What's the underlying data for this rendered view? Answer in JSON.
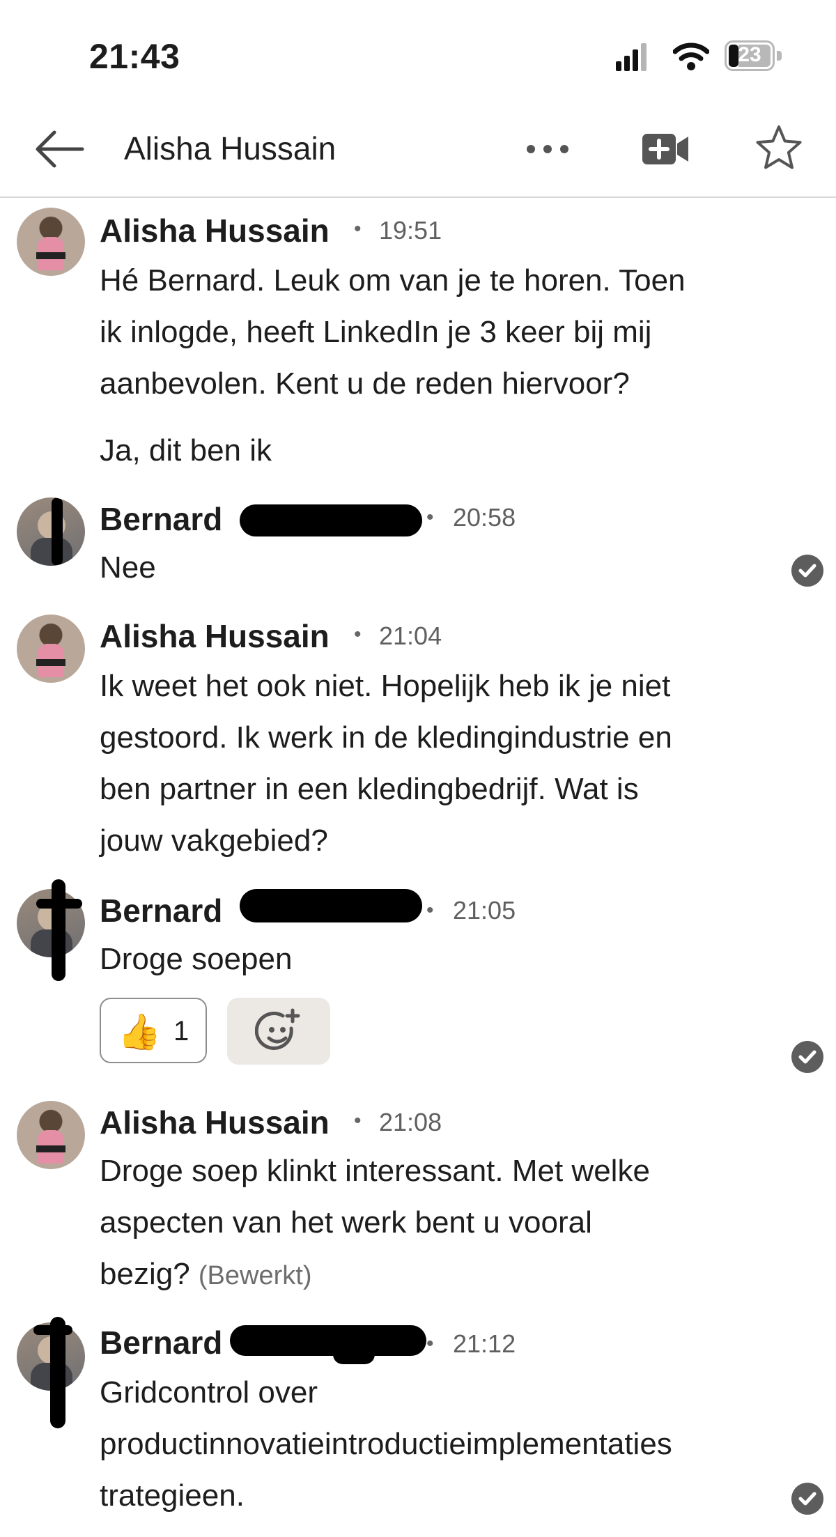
{
  "status_bar": {
    "time": "21:43",
    "battery": "23"
  },
  "header": {
    "back_icon": "arrow-left-icon",
    "title": "Alisha Hussain",
    "more_icon": "more-horizontal-icon",
    "video_icon": "video-call-icon",
    "star_icon": "star-outline-icon"
  },
  "colors": {
    "text": "#1d1d1d",
    "muted": "#5f5f5f",
    "check": "#5d5d5d",
    "reaction_bg": "#ece9e4"
  },
  "messages": [
    {
      "sender": "Alisha Hussain",
      "time": "19:51",
      "lines": [
        "Hé Bernard. Leuk om van je te horen. Toen",
        "ik inlogde, heeft LinkedIn je 3 keer bij mij",
        "aanbevolen. Kent u de reden hiervoor?"
      ],
      "extra": "Ja, dit ben ik"
    },
    {
      "sender": "Bernard",
      "time": "20:58",
      "lines": [
        "Nee"
      ]
    },
    {
      "sender": "Alisha Hussain",
      "time": "21:04",
      "lines": [
        "Ik weet het ook niet. Hopelijk heb ik je niet",
        "gestoord. Ik werk in de kledingindustrie en",
        "ben partner in een kledingbedrijf. Wat is",
        "jouw vakgebied?"
      ]
    },
    {
      "sender": "Bernard",
      "time": "21:05",
      "lines": [
        "Droge soepen"
      ],
      "reaction": {
        "emoji": "👍",
        "count": "1"
      }
    },
    {
      "sender": "Alisha Hussain",
      "time": "21:08",
      "lines": [
        "Droge soep klinkt interessant. Met welke",
        "aspecten van het werk bent u vooral",
        "bezig?"
      ],
      "edited": "(Bewerkt)"
    },
    {
      "sender": "Bernard",
      "time": "21:12",
      "lines": [
        "Gridcontrol over",
        "productinnovatieintroductieimplementaties",
        "trategieen."
      ]
    }
  ]
}
